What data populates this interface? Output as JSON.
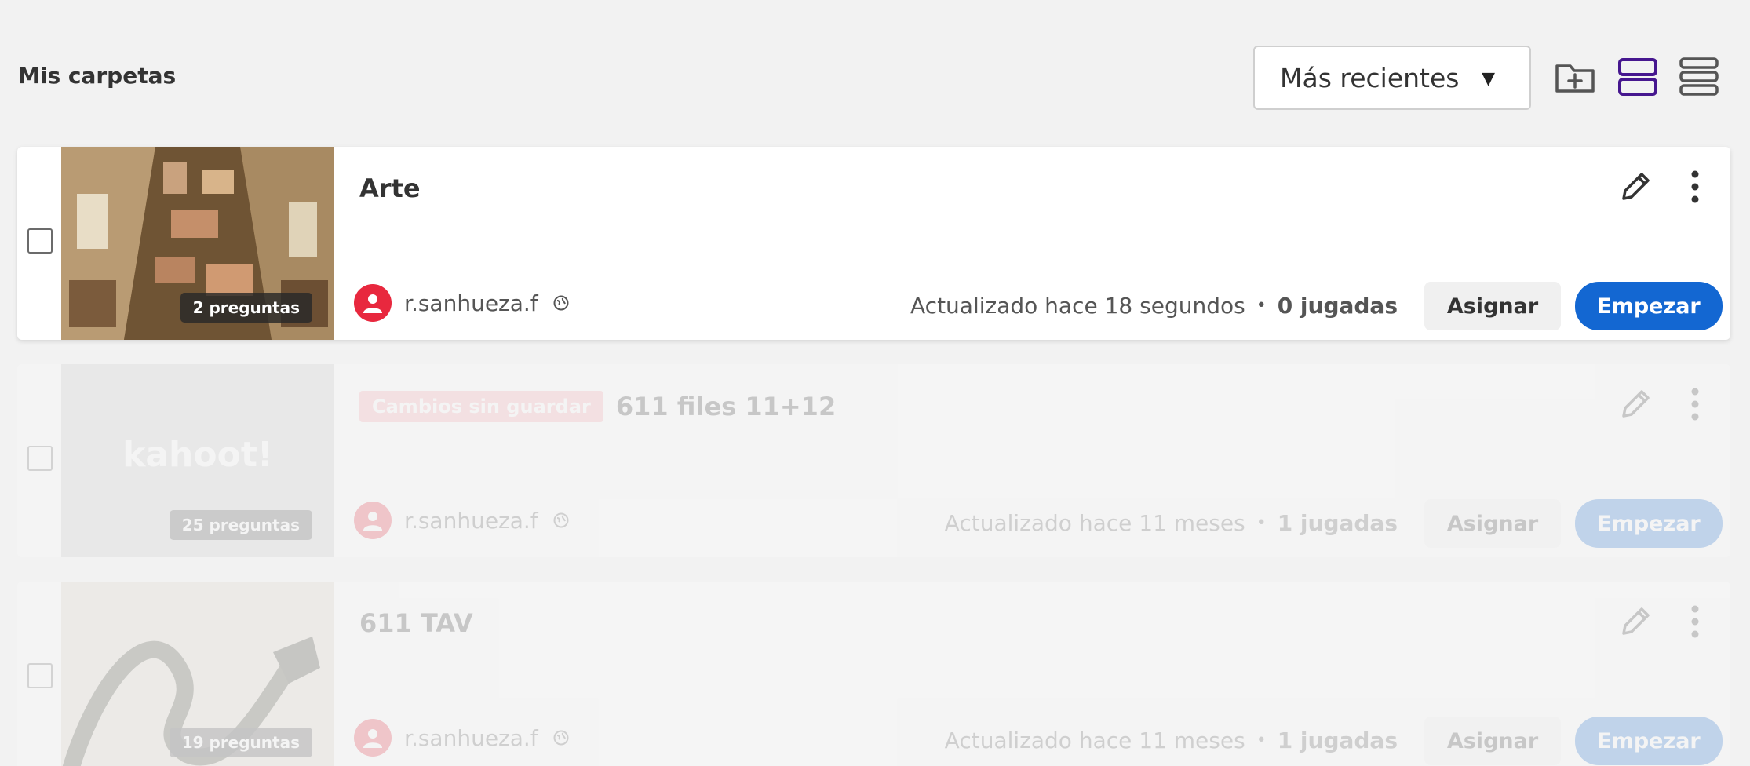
{
  "header": {
    "title": "Mis carpetas",
    "sort": {
      "selected": "Más recientes"
    },
    "icons": [
      "new-folder-icon",
      "card-view-icon",
      "list-view-icon"
    ],
    "accent_color": "#46178f"
  },
  "colors": {
    "start_button": "#1367d2",
    "avatar": "#e8283e",
    "unsaved_badge": "#f8a2ab"
  },
  "cards": [
    {
      "title": "Arte",
      "unsaved_label": "",
      "questions": "2 preguntas",
      "owner": "r.sanhueza.f",
      "updated": "Actualizado hace 18 segundos",
      "plays": "0 jugadas",
      "assign_label": "Asignar",
      "start_label": "Empezar"
    },
    {
      "title": "611 files 11+12",
      "unsaved_label": "Cambios sin guardar",
      "questions": "25 preguntas",
      "thumb_text": "kahoot!",
      "owner": "r.sanhueza.f",
      "updated": "Actualizado hace 11 meses",
      "plays": "1 jugadas",
      "assign_label": "Asignar",
      "start_label": "Empezar"
    },
    {
      "title": "611 TAV",
      "unsaved_label": "",
      "questions": "19 preguntas",
      "owner": "r.sanhueza.f",
      "updated": "Actualizado hace 11 meses",
      "plays": "1 jugadas",
      "assign_label": "Asignar",
      "start_label": "Empezar"
    }
  ]
}
